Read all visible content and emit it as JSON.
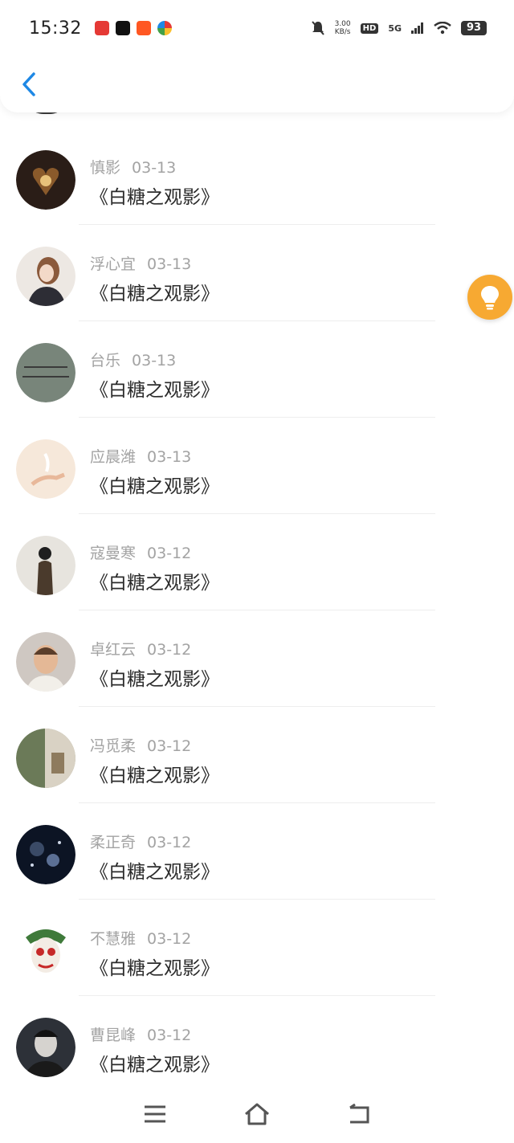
{
  "status_bar": {
    "time": "15:32",
    "app_icons": [
      "news-app-icon",
      "tiktok-icon",
      "taobao-icon",
      "browser-icon"
    ],
    "net_speed_value": "3.00",
    "net_speed_unit": "KB/s",
    "hd_label": "HD",
    "network_label": "5G",
    "battery": "93"
  },
  "colors": {
    "accent": "#1e88e5",
    "hint": "#f7a932",
    "name": "#a3a3a3",
    "title": "#2b2b2b"
  },
  "hint_icon": "lightbulb-icon",
  "list": [
    {
      "name": "慎影",
      "date": "03-13",
      "title": "《白糖之观影》"
    },
    {
      "name": "浮心宜",
      "date": "03-13",
      "title": "《白糖之观影》"
    },
    {
      "name": "台乐",
      "date": "03-13",
      "title": "《白糖之观影》"
    },
    {
      "name": "应晨潍",
      "date": "03-13",
      "title": "《白糖之观影》"
    },
    {
      "name": "寇曼寒",
      "date": "03-12",
      "title": "《白糖之观影》"
    },
    {
      "name": "卓红云",
      "date": "03-12",
      "title": "《白糖之观影》"
    },
    {
      "name": "冯觅柔",
      "date": "03-12",
      "title": "《白糖之观影》"
    },
    {
      "name": "柔正奇",
      "date": "03-12",
      "title": "《白糖之观影》"
    },
    {
      "name": "不慧雅",
      "date": "03-12",
      "title": "《白糖之观影》"
    },
    {
      "name": "曹昆峰",
      "date": "03-12",
      "title": "《白糖之观影》"
    }
  ],
  "nav_bar": [
    "menu-icon",
    "home-icon",
    "back-nav-icon"
  ]
}
